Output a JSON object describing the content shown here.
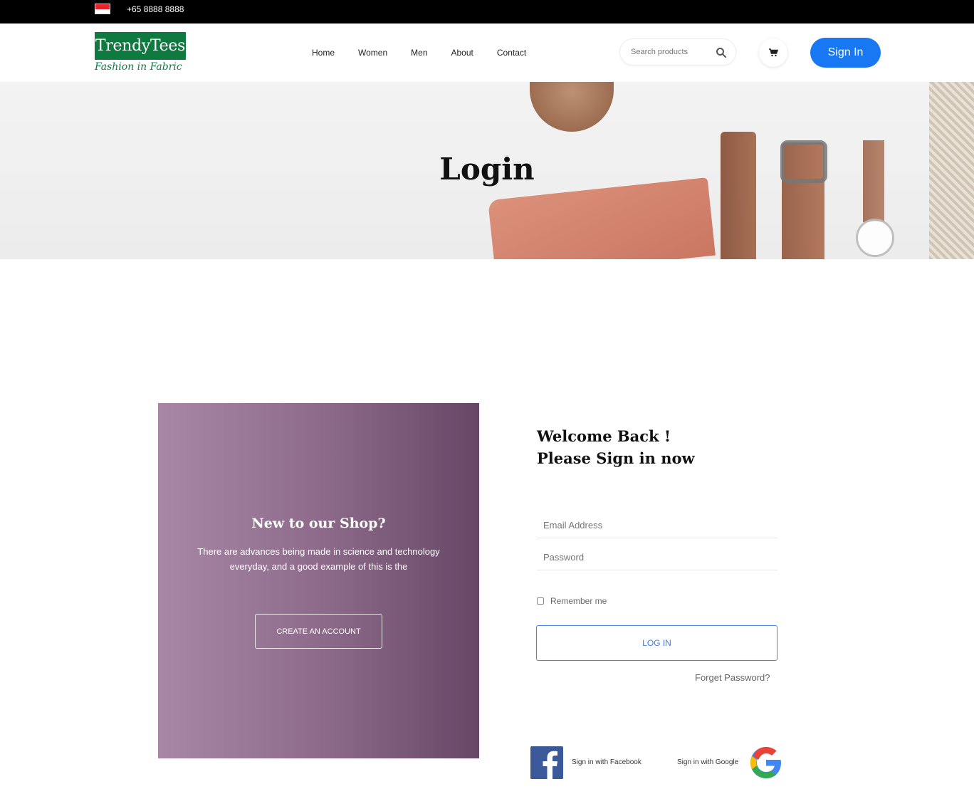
{
  "topbar": {
    "phone": "+65 8888 8888",
    "flag_icon": "singapore-flag-icon"
  },
  "header": {
    "logo_main": "TrendyTees",
    "logo_sub": "Fashion in Fabric",
    "nav": [
      "Home",
      "Women",
      "Men",
      "About",
      "Contact"
    ],
    "search_placeholder": "Search products",
    "search_icon": "search-icon",
    "cart_icon": "cart-icon",
    "signin_label": "Sign In"
  },
  "hero": {
    "title": "Login"
  },
  "register_panel": {
    "title": "New to our Shop?",
    "text": "There are advances being made in science and technology everyday, and a good example of this is the",
    "button_label": "CREATE AN ACCOUNT"
  },
  "login_form": {
    "welcome_line1": "Welcome Back !",
    "welcome_line2": "Please Sign in now",
    "email_placeholder": "Email Address",
    "password_placeholder": "Password",
    "remember_label": "Remember me",
    "login_button": "LOG IN",
    "forgot_label": "Forget Password?",
    "facebook_label": "Sign in with Facebook",
    "google_label": "Sign in with Google"
  },
  "colors": {
    "brand_green": "#0e7a40",
    "accent_blue": "#1877f2",
    "panel_gradient_start": "#a887a6",
    "panel_gradient_end": "#664766"
  }
}
